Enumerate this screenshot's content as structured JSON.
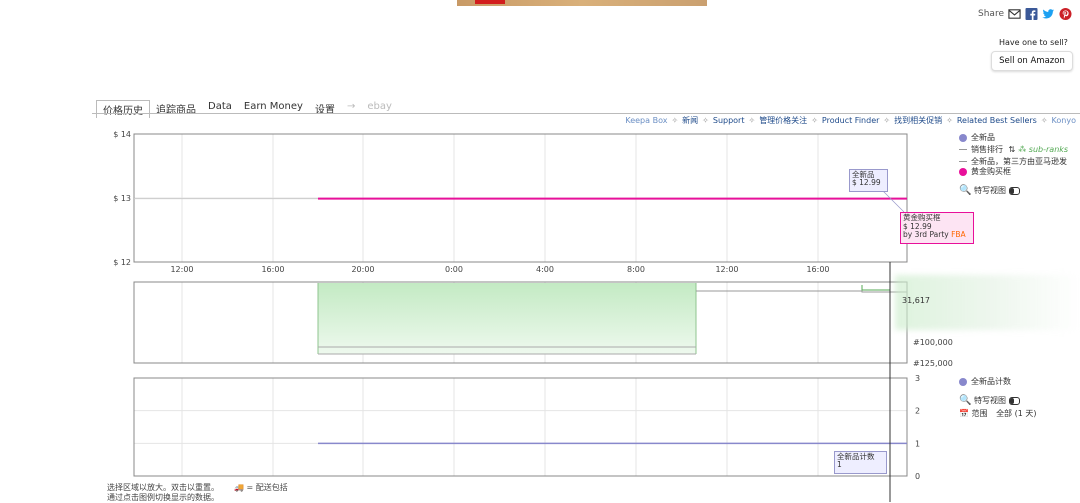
{
  "header": {
    "share_label": "Share",
    "share_icons": [
      "mail-icon",
      "facebook-icon",
      "twitter-icon",
      "pinterest-icon"
    ],
    "sell_question": "Have one to sell?",
    "sell_button": "Sell on Amazon"
  },
  "tabs": [
    {
      "label": "价格历史",
      "active": true
    },
    {
      "label": "追踪商品"
    },
    {
      "label": "Data"
    },
    {
      "label": "Earn Money"
    },
    {
      "label": "设置"
    },
    {
      "label": "→",
      "dim": true
    },
    {
      "label": "ebay",
      "dim": true
    }
  ],
  "links": [
    {
      "label": "Keepa Box",
      "dark": false
    },
    {
      "label": "新闻",
      "dark": true
    },
    {
      "label": "Support",
      "dark": true
    },
    {
      "label": "管理价格关注",
      "dark": true
    },
    {
      "label": "Product Finder",
      "dark": true
    },
    {
      "label": "找到相关促销",
      "dark": true
    },
    {
      "label": "Related Best Sellers",
      "dark": true
    },
    {
      "label": "Konyo",
      "dark": false
    }
  ],
  "link_separator": "✧",
  "colors": {
    "new": "#8888cc",
    "buybox": "#e8109a",
    "sales_fill": "#cdeecd",
    "sales_line": "#8fc48f",
    "count": "#8888cc",
    "grid": "#e4e4e4",
    "frame": "#888888"
  },
  "chart_data": {
    "type": "line",
    "x_ticks": [
      "12:00",
      "16:00",
      "20:00",
      "0:00",
      "4:00",
      "8:00",
      "12:00",
      "16:00"
    ],
    "price": {
      "y_ticks": [
        "$ 14",
        "$ 13",
        "$ 12"
      ],
      "ylim": [
        12,
        14
      ],
      "series": [
        {
          "name": "全新品",
          "price": 12.99,
          "color": "#8888cc"
        },
        {
          "name": "黄金购买框",
          "price": 12.99,
          "color": "#e8109a"
        }
      ]
    },
    "rank": {
      "y_ticks": [
        "#100,000",
        "#125,000"
      ],
      "current_label": "31,617"
    },
    "offers": {
      "y_ticks": [
        "3",
        "2",
        "1",
        "0"
      ],
      "ylim": [
        0,
        3
      ],
      "series": [
        {
          "name": "全新品计数",
          "value": 1,
          "color": "#8888cc"
        }
      ]
    }
  },
  "tooltips": {
    "new_name": "全新品",
    "new_price": "$ 12.99",
    "buybox_name": "黄金购买框",
    "buybox_price": "$ 12.99",
    "buybox_by": "by 3rd Party",
    "buybox_flag": "FBA",
    "count_name": "全新品计数",
    "count_value": "1"
  },
  "legend_top": {
    "new": "全新品",
    "rank": "销售排行",
    "subranks": "sub-ranks",
    "third_party": "全新品，第三方由亚马逊发",
    "buybox": "黄金购买框",
    "close_view": "特写视图"
  },
  "legend_bottom": {
    "count": "全新品计数",
    "close_view": "特写视图",
    "range_label": "范围",
    "range_value": "全部 (1 天)"
  },
  "footer": {
    "line1": "选择区域以放大。双击以重置。",
    "line2": "通过点击图例切换显示的数据。",
    "shipping": "= 配送包括"
  }
}
